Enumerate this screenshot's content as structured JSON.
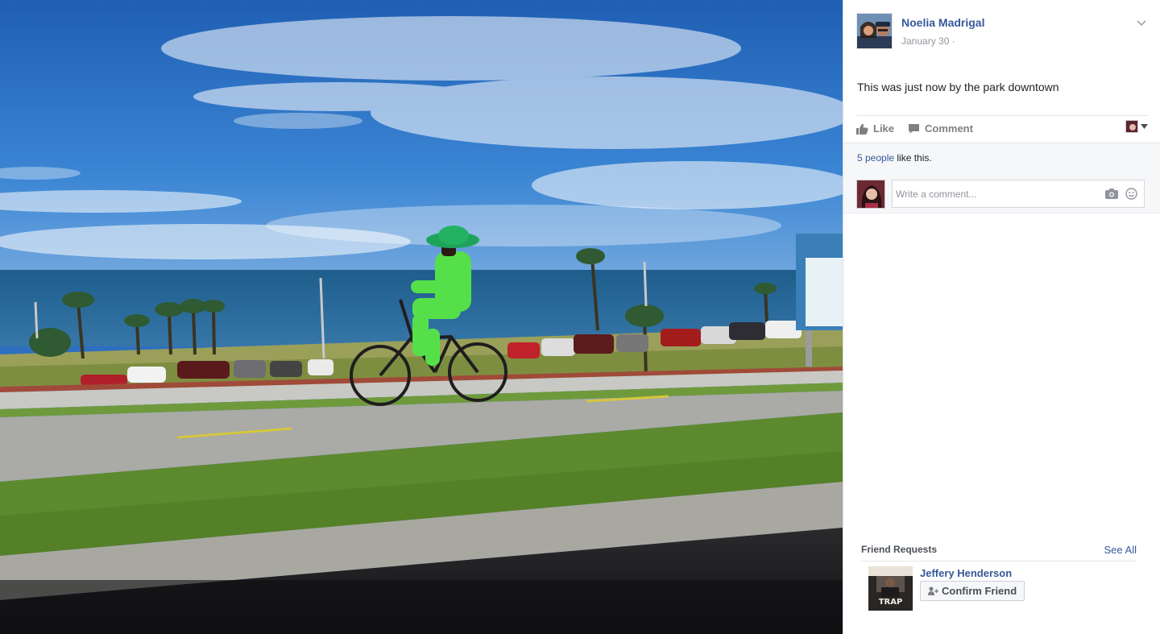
{
  "post": {
    "author_name": "Noelia Madrigal",
    "date": "January 30",
    "time_separator": "·",
    "text": "This was just now by the park downtown"
  },
  "actions": {
    "like_label": "Like",
    "comment_label": "Comment"
  },
  "likes": {
    "people_link": "5 people",
    "suffix": " like this."
  },
  "comment": {
    "placeholder": "Write a comment..."
  },
  "friend_requests": {
    "title": "Friend Requests",
    "see_all": "See All",
    "requester_name": "Jeffery Henderson",
    "confirm_label": "Confirm Friend",
    "album_art_text": "TRAP"
  },
  "icons": {
    "chevron": "chevron-down-icon",
    "like": "thumbs-up-icon",
    "comment": "speech-bubble-icon",
    "camera": "camera-icon",
    "smiley": "smiley-icon",
    "add_friend": "add-friend-icon"
  },
  "colors": {
    "link_blue": "#365899",
    "sky": "#2f74c8",
    "suit_green": "#55e04a",
    "hat_green": "#1fa35a",
    "grass": "#5d8a2e"
  }
}
